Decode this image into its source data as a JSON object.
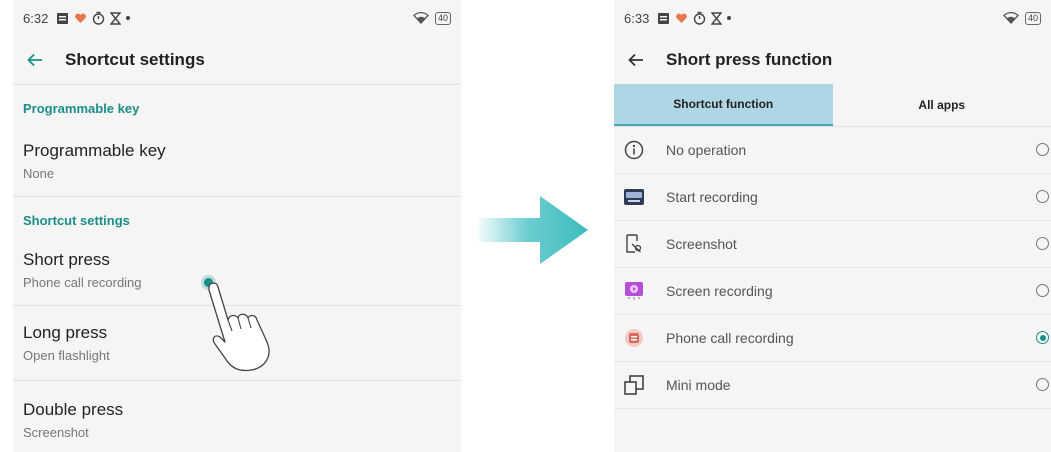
{
  "left": {
    "status_time": "6:32",
    "battery": "40",
    "title": "Shortcut settings",
    "sections": [
      {
        "header": "Programmable key",
        "items": [
          {
            "title": "Programmable key",
            "value": "None"
          }
        ]
      },
      {
        "header": "Shortcut settings",
        "items": [
          {
            "title": "Short press",
            "value": "Phone call recording"
          },
          {
            "title": "Long press",
            "value": "Open flashlight"
          },
          {
            "title": "Double press",
            "value": "Screenshot"
          }
        ]
      }
    ]
  },
  "right": {
    "status_time": "6:33",
    "battery": "40",
    "title": "Short press function",
    "tabs": [
      {
        "label": "Shortcut function",
        "active": true
      },
      {
        "label": "All apps",
        "active": false
      }
    ],
    "options": [
      {
        "label": "No operation",
        "icon": "info-icon",
        "selected": false
      },
      {
        "label": "Start recording",
        "icon": "recorder-icon",
        "selected": false
      },
      {
        "label": "Screenshot",
        "icon": "screenshot-icon",
        "selected": false
      },
      {
        "label": "Screen recording",
        "icon": "screen-recording-icon",
        "selected": false
      },
      {
        "label": "Phone call recording",
        "icon": "call-recording-icon",
        "selected": true
      },
      {
        "label": "Mini mode",
        "icon": "mini-mode-icon",
        "selected": false
      }
    ]
  },
  "colors": {
    "accent": "#1a8e88",
    "tab_active": "#aed6e4",
    "arrow": "#3bbcc0",
    "background": "#f5f5f5"
  }
}
